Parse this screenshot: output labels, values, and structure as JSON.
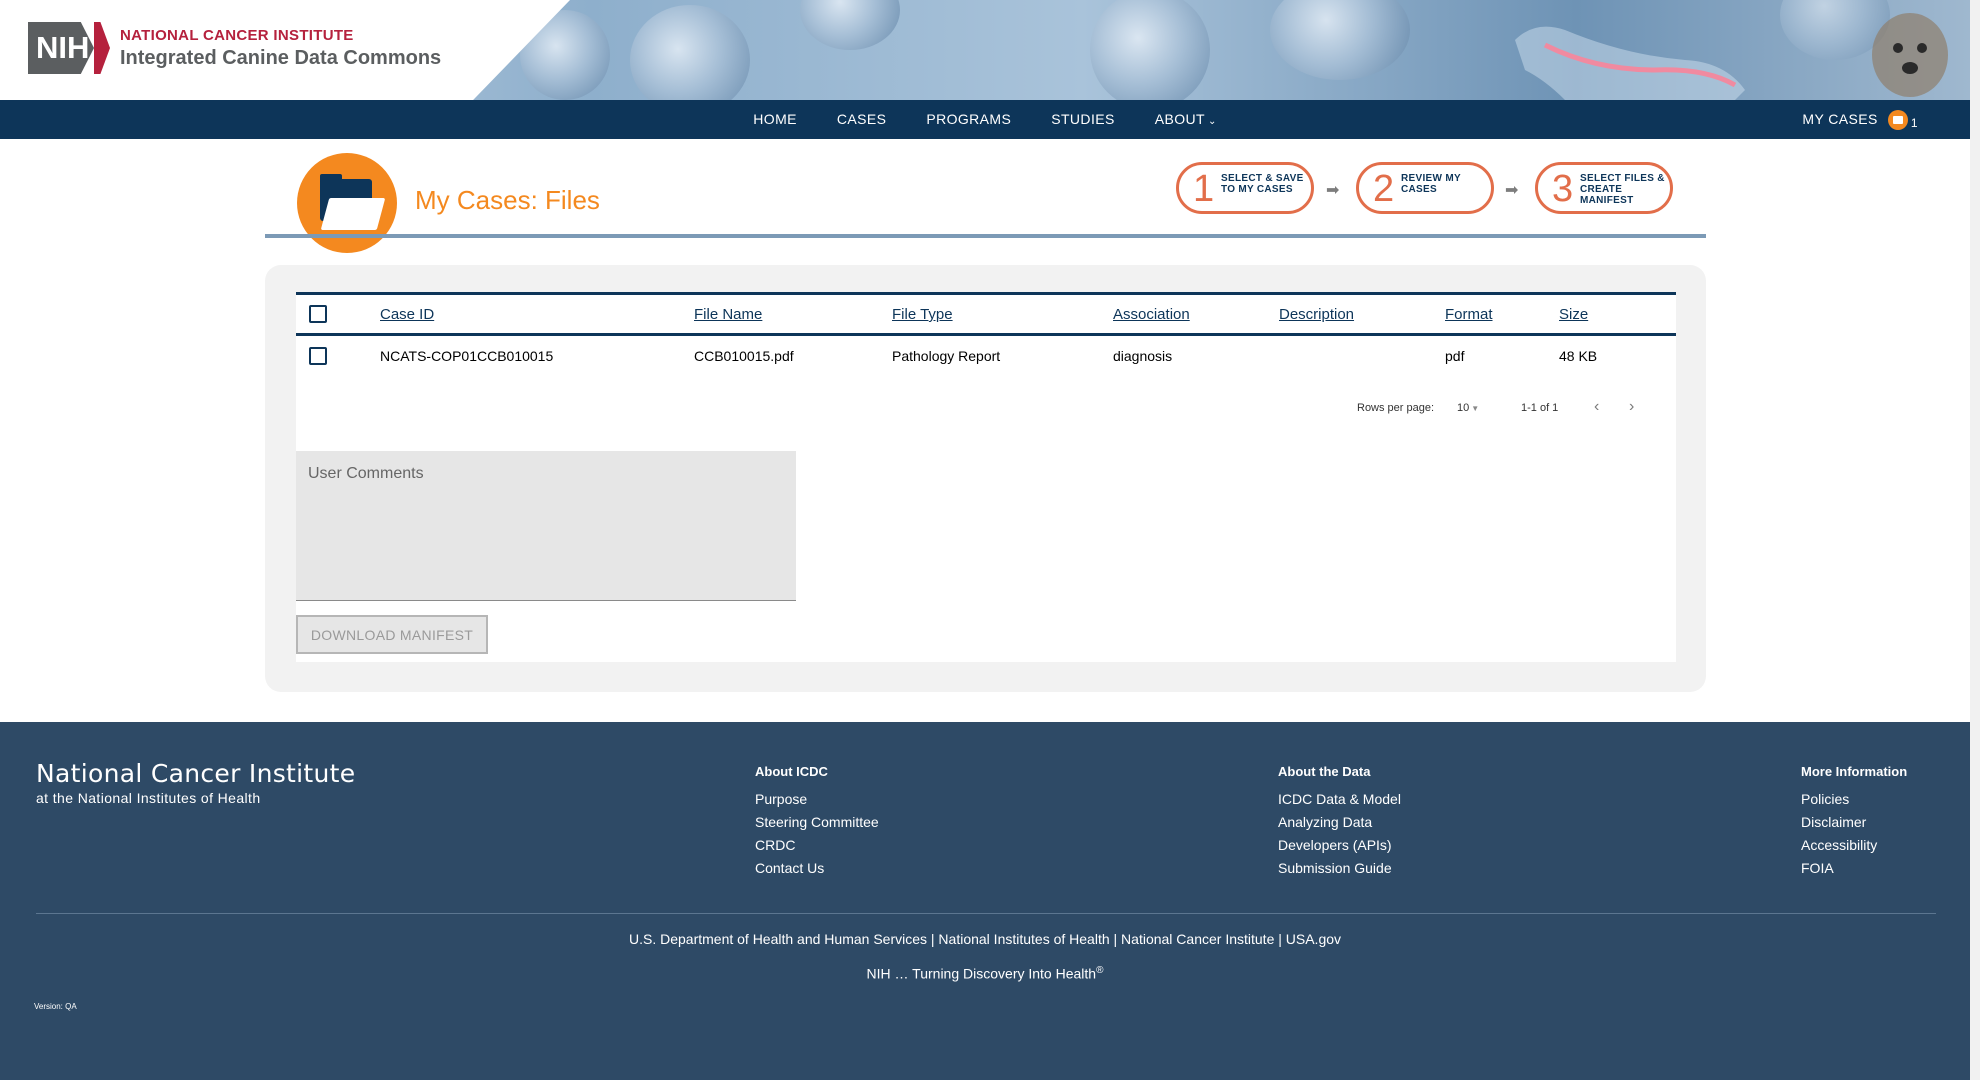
{
  "header": {
    "nih_logo_text": "NIH",
    "org_title": "NATIONAL CANCER INSTITUTE",
    "site_title": "Integrated Canine Data Commons"
  },
  "nav": {
    "items": [
      {
        "label": "HOME"
      },
      {
        "label": "CASES"
      },
      {
        "label": "PROGRAMS"
      },
      {
        "label": "STUDIES"
      },
      {
        "label": "ABOUT"
      }
    ],
    "about_chevron": "⌄",
    "my_cases_label": "MY CASES",
    "my_cases_count": "1"
  },
  "page": {
    "title": "My Cases: Files",
    "steps": [
      {
        "number": "1",
        "text": "SELECT & SAVE TO MY CASES"
      },
      {
        "number": "2",
        "text": "REVIEW MY CASES"
      },
      {
        "number": "3",
        "text": "SELECT FILES & CREATE MANIFEST"
      }
    ],
    "step_arrow": "➡"
  },
  "table": {
    "columns": [
      "Case ID",
      "File Name",
      "File Type",
      "Association",
      "Description",
      "Format",
      "Size"
    ],
    "rows": [
      {
        "case_id": "NCATS-COP01CCB010015",
        "file_name": "CCB010015.pdf",
        "file_type": "Pathology Report",
        "association": "diagnosis",
        "description": "",
        "format": "pdf",
        "size": "48 KB"
      }
    ],
    "rows_per_page_label": "Rows per page:",
    "rows_per_page_value": "10",
    "range_label": "1-1 of 1",
    "prev_icon": "‹",
    "next_icon": "›"
  },
  "comments": {
    "placeholder": "User Comments"
  },
  "download_button": "DOWNLOAD MANIFEST",
  "footer": {
    "brand_title": "National Cancer Institute",
    "brand_subtitle": "at the National Institutes of Health",
    "columns": [
      {
        "heading": "About ICDC",
        "links": [
          "Purpose",
          "Steering Committee",
          "CRDC",
          "Contact Us"
        ]
      },
      {
        "heading": "About the Data",
        "links": [
          "ICDC Data & Model",
          "Analyzing Data",
          "Developers (APIs)",
          "Submission Guide"
        ]
      },
      {
        "heading": "More Information",
        "links": [
          "Policies",
          "Disclaimer",
          "Accessibility",
          "FOIA"
        ]
      }
    ],
    "line1": "U.S. Department of Health and Human Services | National Institutes of Health | National Cancer Institute | USA.gov",
    "line2": "NIH … Turning Discovery Into Health",
    "line2_mark": "®",
    "version": "Version: QA"
  },
  "colors": {
    "navy": "#0d3559",
    "orange": "#f4891f",
    "step_red": "#e26e4a",
    "footer_bg": "#2e4a66",
    "nih_red": "#b5213d"
  }
}
